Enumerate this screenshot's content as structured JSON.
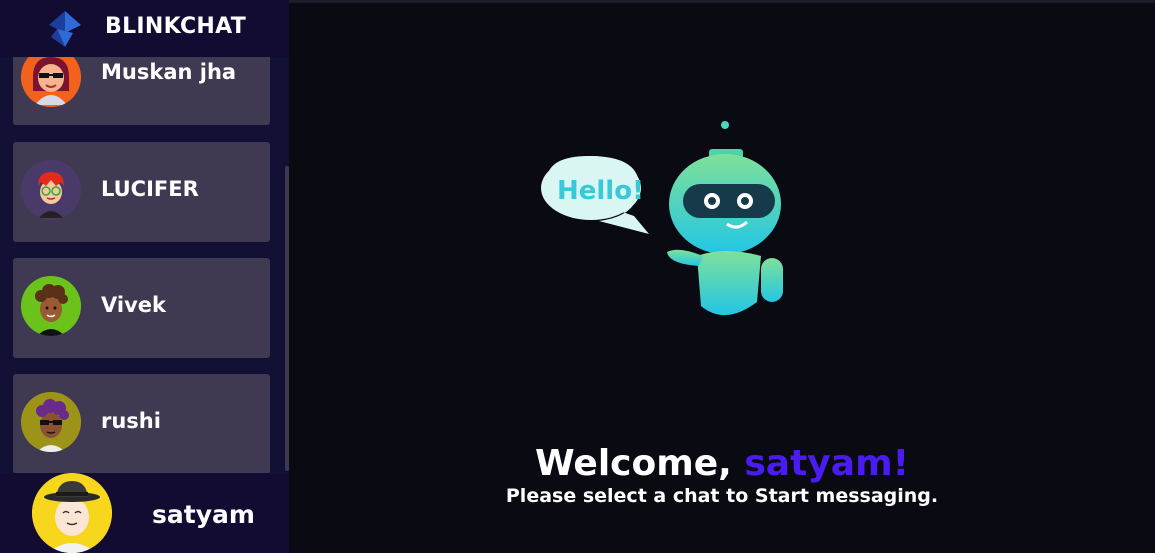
{
  "app": {
    "name": "BLINKCHAT"
  },
  "contacts": [
    {
      "name": "Muskan jha",
      "avatar": "avatar-woman-sunglasses"
    },
    {
      "name": "LUCIFER",
      "avatar": "avatar-redhair-glasses"
    },
    {
      "name": "Vivek",
      "avatar": "avatar-curly-hair"
    },
    {
      "name": "rushi",
      "avatar": "avatar-purple-hair-sunglasses"
    }
  ],
  "current_user": {
    "name": "satyam",
    "avatar": "avatar-hat-man"
  },
  "welcome": {
    "prefix": "Welcome, ",
    "user": "satyam!",
    "subtitle": "Please select a chat to Start messaging."
  },
  "illustration": {
    "bubble_text": "Hello!"
  },
  "colors": {
    "accent": "#4a1cf2",
    "card": "#403952",
    "sidebar": "#131036",
    "background": "#0a0a13"
  }
}
